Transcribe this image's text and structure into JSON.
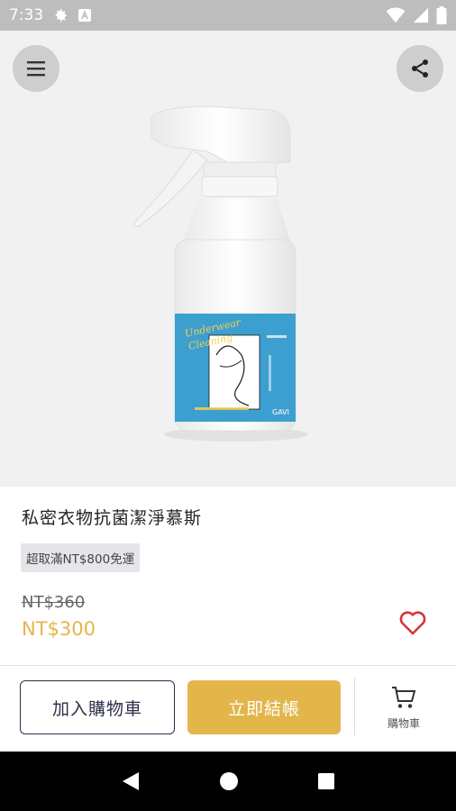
{
  "status_bar": {
    "time": "7:33"
  },
  "product": {
    "title": "私密衣物抗菌潔淨慕斯",
    "shipping_badge": "超取滿NT$800免運",
    "original_price": "NT$360",
    "sale_price": "NT$300",
    "label_text_line1": "Underwear",
    "label_text_line2": "Cleaning",
    "label_brand": "GAVI"
  },
  "actions": {
    "add_to_cart": "加入購物車",
    "checkout": "立即結帳",
    "cart_tab": "購物車"
  },
  "colors": {
    "accent": "#e3b64b",
    "primary_text": "#2c2f4a",
    "heart": "#d6333a",
    "label_blue": "#3d9fd0"
  },
  "icons": {
    "menu": "menu-icon",
    "share": "share-icon",
    "favorite": "heart-icon",
    "cart": "cart-icon"
  }
}
